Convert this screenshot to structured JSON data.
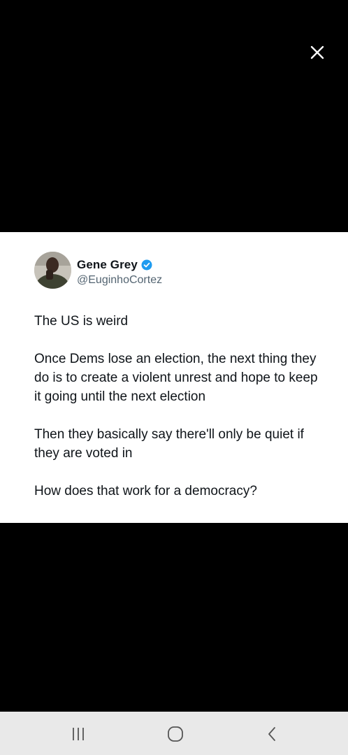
{
  "viewer": {
    "close_icon": "close-icon"
  },
  "tweet": {
    "display_name": "Gene Grey",
    "handle": "@EuginhoCortez",
    "verified_icon": "verified-badge-icon",
    "verified_color": "#1d9bf0",
    "paragraphs": [
      "The US is weird",
      "Once Dems lose an election, the next thing they do is to create a violent unrest and hope to keep it going until the next election",
      "Then they basically say there'll only be quiet if they are voted in",
      "How does that work for a democracy?"
    ]
  },
  "nav_bar": {
    "recent_apps_icon": "recent-apps-icon",
    "home_icon": "home-icon",
    "back_icon": "back-icon"
  }
}
